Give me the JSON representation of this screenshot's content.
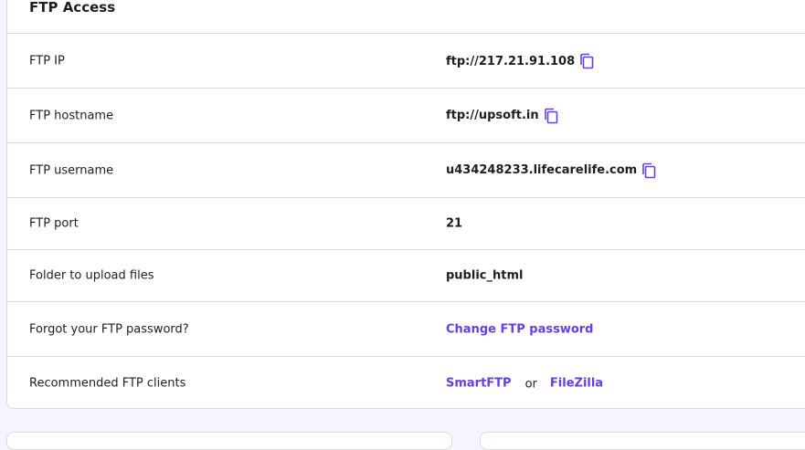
{
  "ftp_access": {
    "title": "FTP Access",
    "rows": [
      {
        "label": "FTP IP",
        "value": "ftp://217.21.91.108"
      },
      {
        "label": "FTP hostname",
        "value": "ftp://upsoft.in"
      },
      {
        "label": "FTP username",
        "value": "u434248233.lifecarelife.com"
      },
      {
        "label": "FTP port",
        "value": "21"
      },
      {
        "label": "Folder to upload files",
        "value": "public_html"
      },
      {
        "label": "Forgot your FTP password?",
        "link": "Change FTP password"
      },
      {
        "label": "Recommended FTP clients",
        "client1": "SmartFTP",
        "separator": "or",
        "client2": "FileZilla"
      }
    ]
  },
  "colors": {
    "accent": "#673de6",
    "border": "#dadce0",
    "background": "#f4f5ff"
  },
  "icons": {
    "copy": "copy-icon"
  }
}
